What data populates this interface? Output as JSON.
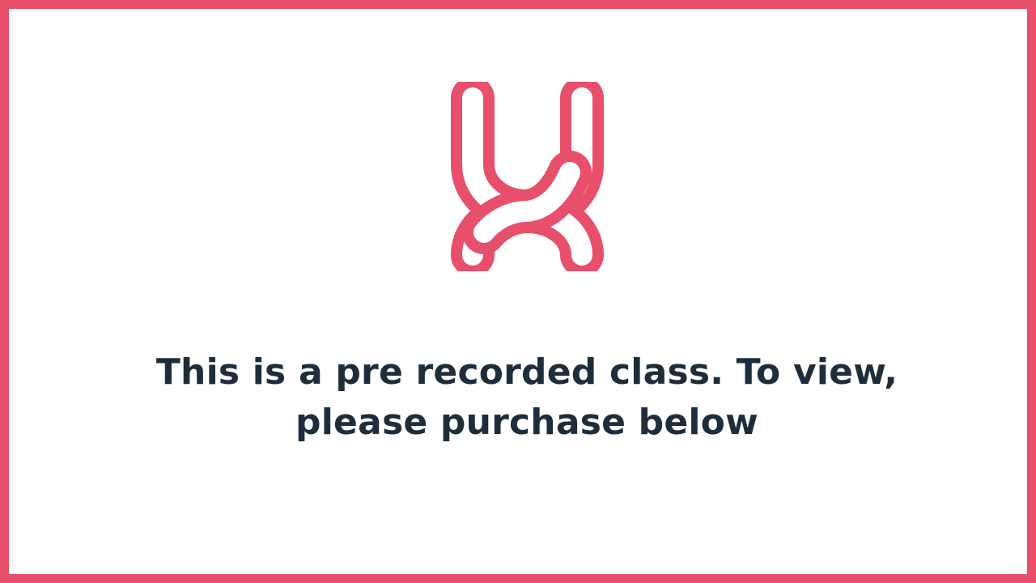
{
  "page": {
    "border_color": "#e84f6a",
    "background_color": "#ffffff"
  },
  "logo": {
    "icon": "h-interlocking-logo-icon",
    "color": "#e84f6a"
  },
  "message": {
    "line1": "This is a pre recorded class. To view,",
    "line2": "please purchase below",
    "color": "#1e2d3b"
  }
}
